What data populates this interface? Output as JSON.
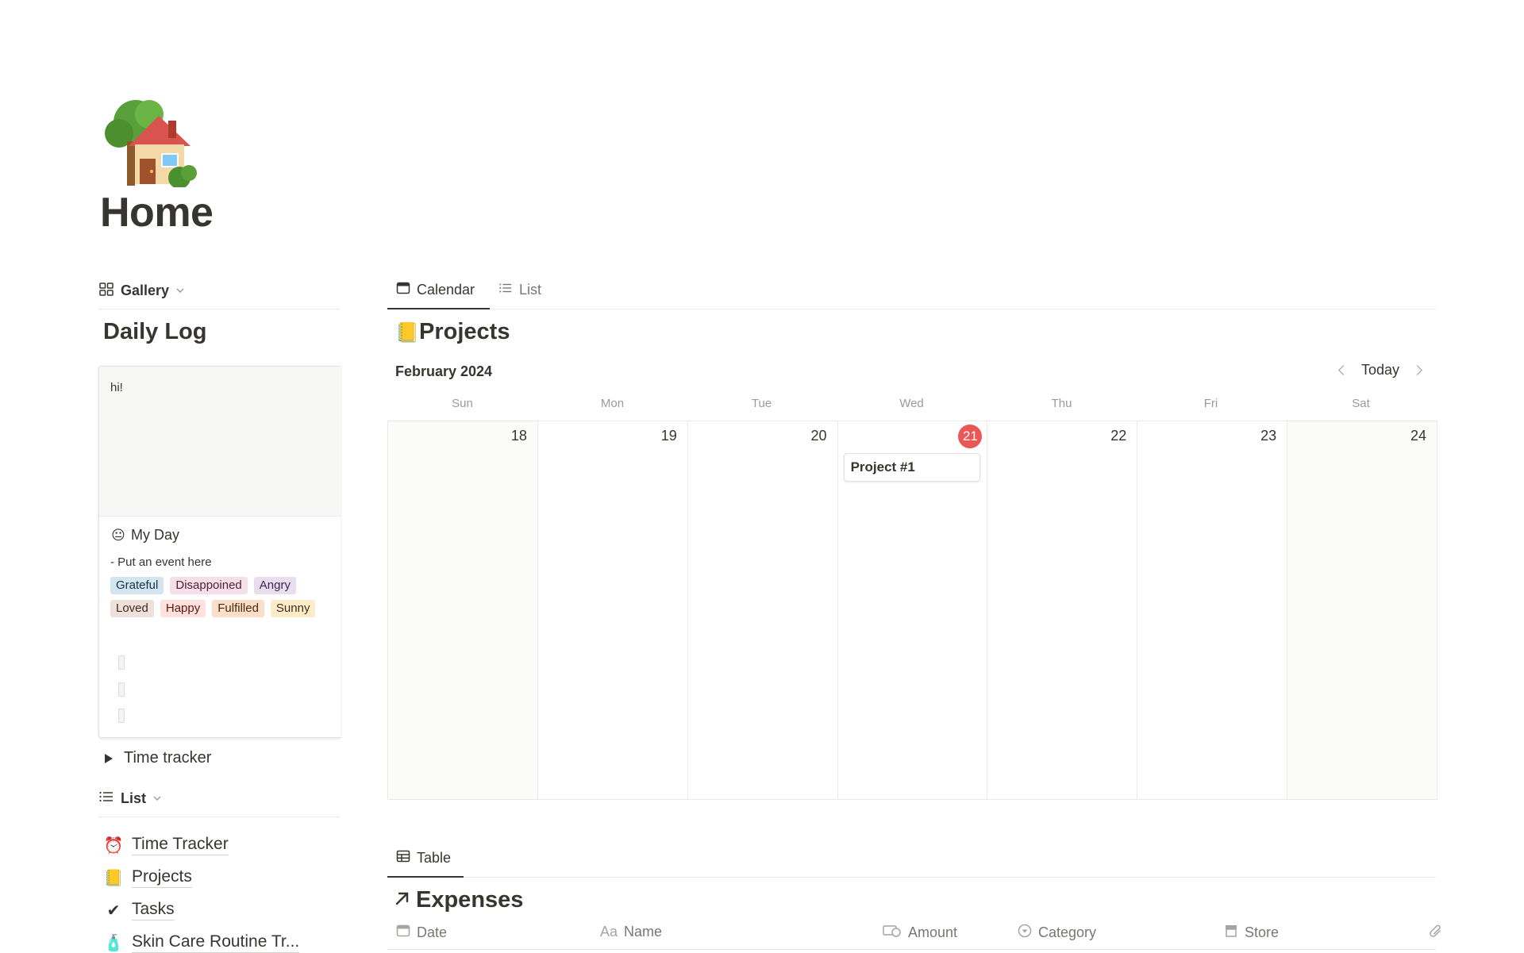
{
  "page": {
    "title": "Home",
    "icon": "house-with-tree-icon"
  },
  "left_view": {
    "view_label": "Gallery",
    "section_title": "Daily Log",
    "card": {
      "preview_text": "hi!",
      "emoji": "😐",
      "title": "My Day",
      "description": "- Put an event here",
      "tags": [
        {
          "label": "Grateful",
          "bg": "#d3e5ef",
          "fg": "#183347"
        },
        {
          "label": "Disappoined",
          "bg": "#f5e0e9",
          "fg": "#4c2337"
        },
        {
          "label": "Angry",
          "bg": "#e8deee",
          "fg": "#412454"
        },
        {
          "label": "Loved",
          "bg": "#eee0da",
          "fg": "#442a1e"
        },
        {
          "label": "Happy",
          "bg": "#ffe2dd",
          "fg": "#5d1715"
        },
        {
          "label": "Fulfilled",
          "bg": "#fadec9",
          "fg": "#49290e"
        },
        {
          "label": "Sunny",
          "bg": "#fdecc8",
          "fg": "#402c1b"
        }
      ]
    },
    "toggle_label": "Time tracker"
  },
  "list_view": {
    "view_label": "List",
    "items": [
      {
        "emoji": "⏰",
        "label": "Time Tracker"
      },
      {
        "emoji": "📒",
        "label": "Projects"
      },
      {
        "emoji": "✔",
        "label": "Tasks"
      },
      {
        "emoji": "🧴",
        "label": "Skin Care Routine Tr..."
      }
    ]
  },
  "calendar_view": {
    "tabs": [
      {
        "label": "Calendar",
        "active": true
      },
      {
        "label": "List",
        "active": false
      }
    ],
    "section_emoji": "📒",
    "section_title": "Projects",
    "month": "February 2024",
    "today_label": "Today",
    "weekdays": [
      "Sun",
      "Mon",
      "Tue",
      "Wed",
      "Thu",
      "Fri",
      "Sat"
    ],
    "days": [
      "18",
      "19",
      "20",
      "21",
      "22",
      "23",
      "24"
    ],
    "today_index": 3,
    "event": {
      "day_index": 3,
      "title": "Project #1"
    }
  },
  "table_view": {
    "tab_label": "Table",
    "section_title": "Expenses",
    "columns": [
      {
        "icon": "calendar-icon",
        "label": "Date"
      },
      {
        "icon": "text-aa-icon",
        "label": "Name",
        "icon_text": "Aa"
      },
      {
        "icon": "currency-icon",
        "label": "Amount"
      },
      {
        "icon": "select-icon",
        "label": "Category"
      },
      {
        "icon": "store-icon",
        "label": "Store"
      }
    ]
  }
}
